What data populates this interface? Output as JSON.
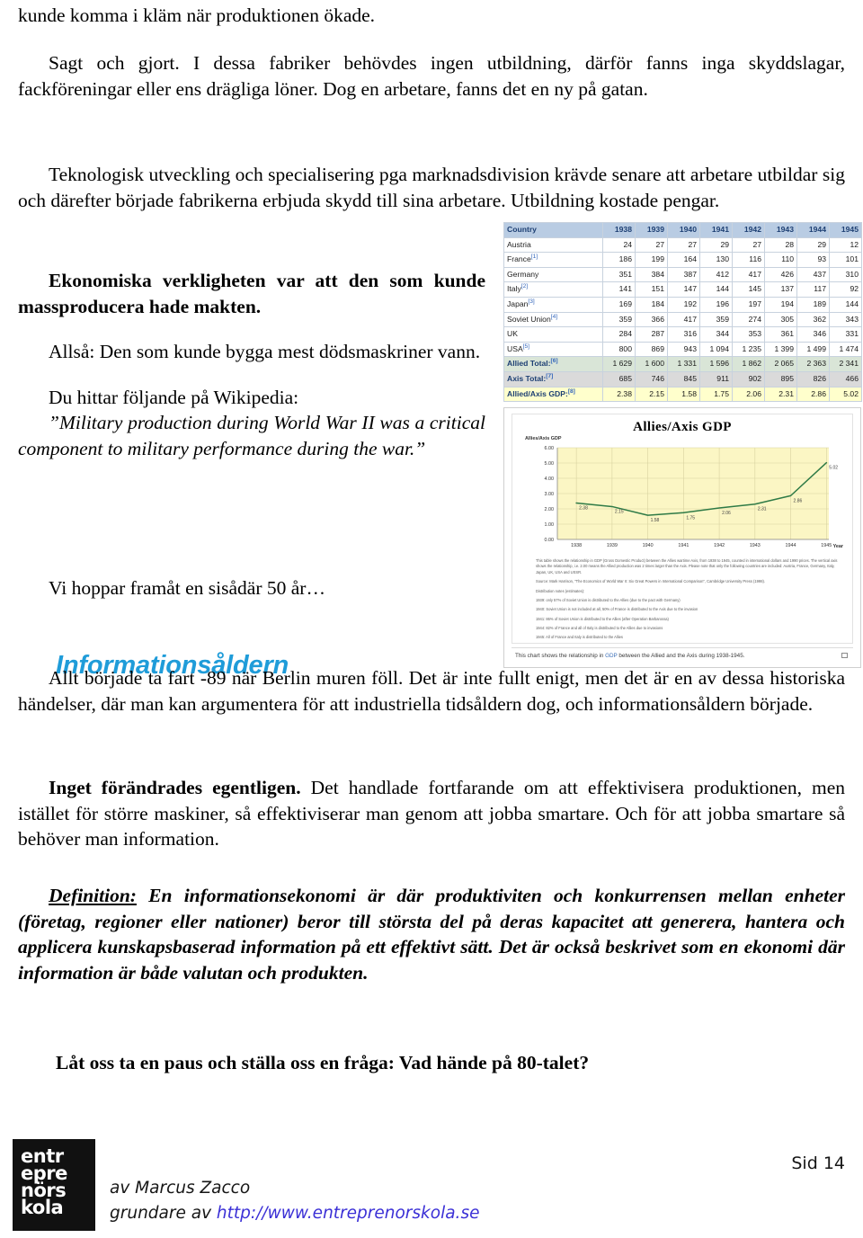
{
  "page": {
    "language": "sv",
    "page_label": "Sid 14",
    "heading_color": "#1f9cd9",
    "link_color": "#3b30d6"
  },
  "text": {
    "line_top": "kunde komma i kläm när produktionen ökade.",
    "para_fabriker": "Sagt och gjort. I dessa fabriker behövdes ingen utbildning, därför fanns inga skyddslagar, fackföreningar eller ens drägliga löner. Dog en arbetare, fanns det en ny på gatan.",
    "para_teknologisk": "Teknologisk utveckling och specialisering pga marknadsdivision krävde senare att arbetare utbildar sig och därefter började fabrikerna erbjuda skydd till sina arbetare. Utbildning kostade pengar.",
    "para_ekonomiska": "Ekonomiska verkligheten var att den som kunde massproducera hade makten.",
    "para_allsa": "Allså: Den som kunde bygga mest dödsmaskriner vann.",
    "para_wikipedia_intro": "Du hittar följande på Wikipedia:",
    "para_wikipedia_quote": "”Military production during World War II was a critical component to military performance during the war.”",
    "para_vihoppar": "Vi hoppar framåt en sisådär 50 år…",
    "heading_informationsaldern": "Informationsåldern",
    "para_allt_borjade": "Allt började ta fart -89 när Berlin muren föll. Det är inte fullt enigt, men det är en av dessa historiska händelser, där man kan argumentera för att industriella tidsåldern dog, och informationsåldern började.",
    "para_inget_bold": "Inget förändrades egentligen.",
    "para_inget_rest": " Det handlade fortfarande om att effektivisera produktionen, men istället för större maskiner, så effektiviserar man genom att jobba smartare. Och för att jobba smartare så behöver man information.",
    "para_definition_label": "Definition:",
    "para_definition_rest": " En informationsekonomi är där produktiviten och konkurrensen mellan enheter (företag, regioner eller nationer) beror till största del på deras kapacitet att generera, hantera och applicera kunskapsbaserad information på ett effektivt sätt. Det är också beskrivet som en ekonomi där information är både valutan och produkten.",
    "para_fraga": "Låt oss ta en paus och ställa oss en fråga: Vad hände på 80-talet?"
  },
  "figure": {
    "table": {
      "headers": [
        "Country",
        "1938",
        "1939",
        "1940",
        "1941",
        "1942",
        "1943",
        "1944",
        "1945"
      ],
      "rows": [
        {
          "name": "Austria",
          "ref": "",
          "style": "plain",
          "values": [
            "24",
            "27",
            "27",
            "29",
            "27",
            "28",
            "29",
            "12"
          ]
        },
        {
          "name": "France",
          "ref": "[1]",
          "style": "plain",
          "values": [
            "186",
            "199",
            "164",
            "130",
            "116",
            "110",
            "93",
            "101"
          ]
        },
        {
          "name": "Germany",
          "ref": "",
          "style": "plain",
          "values": [
            "351",
            "384",
            "387",
            "412",
            "417",
            "426",
            "437",
            "310"
          ]
        },
        {
          "name": "Italy",
          "ref": "[2]",
          "style": "plain",
          "values": [
            "141",
            "151",
            "147",
            "144",
            "145",
            "137",
            "117",
            "92"
          ]
        },
        {
          "name": "Japan",
          "ref": "[3]",
          "style": "plain",
          "values": [
            "169",
            "184",
            "192",
            "196",
            "197",
            "194",
            "189",
            "144"
          ]
        },
        {
          "name": "Soviet Union",
          "ref": "[4]",
          "style": "plain",
          "values": [
            "359",
            "366",
            "417",
            "359",
            "274",
            "305",
            "362",
            "343"
          ]
        },
        {
          "name": "UK",
          "ref": "",
          "style": "plain",
          "values": [
            "284",
            "287",
            "316",
            "344",
            "353",
            "361",
            "346",
            "331"
          ]
        },
        {
          "name": "USA",
          "ref": "[5]",
          "style": "plain",
          "values": [
            "800",
            "869",
            "943",
            "1 094",
            "1 235",
            "1 399",
            "1 499",
            "1 474"
          ]
        },
        {
          "name": "Allied Total:",
          "ref": "[6]",
          "style": "allied",
          "values": [
            "1 629",
            "1 600",
            "1 331",
            "1 596",
            "1 862",
            "2 065",
            "2 363",
            "2 341"
          ]
        },
        {
          "name": "Axis Total:",
          "ref": "[7]",
          "style": "axis",
          "values": [
            "685",
            "746",
            "845",
            "911",
            "902",
            "895",
            "826",
            "466"
          ]
        },
        {
          "name": "Allied/Axis GDP:",
          "ref": "[8]",
          "style": "gdp",
          "values": [
            "2.38",
            "2.15",
            "1.58",
            "1.75",
            "2.06",
            "2.31",
            "2.86",
            "5.02"
          ]
        }
      ]
    },
    "notes": [
      "This table shows the relationship in GDP (Gross Domestic Product) between the Allies wartime Axis, from 1938 to 1945, counted in international dollars and 1990 prices. The vertical axis shows the relationship, i.e. 2.00 means the Allied production was 2 times larger than the Axis. Please note that only the following countries are included: Austria, France, Germany, Italy, Japan, UK, USA and USSR.",
      "Source: Mark Harrison, \"The Economics of World War II: Six Great Powers in International Comparison\", Cambridge University Press (1998).",
      "Distribution notes (estimates):",
      "1939: only 57% of Soviet Union is distributed to the Allies (due to the pact with Germany)",
      "1940: Soviet Union is not included at all, 50% of France is distributed to the Axis due to the invasion",
      "1941: 86% of Soviet Union is distributed to the Allies (after Operation Barbarossa)",
      "1944: 82% of France and all of Italy is distributed to the Allies due to invasions",
      "1945: All of France and Italy is distributed to the Allies"
    ],
    "caption_pre": "This chart shows the relationship in ",
    "caption_link": "GDP",
    "caption_post": " between the Allied and the Axis during 1938-1945."
  },
  "chart_data": {
    "type": "line",
    "title": "Allies/Axis GDP",
    "xlabel": "Year",
    "ylabel": "Allies/Axis GDP",
    "categories": [
      "1938",
      "1939",
      "1940",
      "1941",
      "1942",
      "1943",
      "1944",
      "1945"
    ],
    "values": [
      2.38,
      2.15,
      1.58,
      1.75,
      2.06,
      2.31,
      2.86,
      5.02
    ],
    "point_labels": [
      "2.38",
      "2.15",
      "1.58",
      "1.75",
      "2.06",
      "2.31",
      "2.86",
      "5.02"
    ],
    "ylim": [
      0.0,
      6.0
    ],
    "ytick_step": 1.0,
    "yticks": [
      "0.00",
      "1.00",
      "2.00",
      "3.00",
      "4.00",
      "5.00",
      "6.00"
    ],
    "grid": true,
    "legend": "none",
    "plot_bg": "#fbf6c4",
    "line_color": "#2e7a46"
  },
  "footer": {
    "logo_lines": [
      "entr",
      "epre",
      "nörs",
      "kola"
    ],
    "byline": "av Marcus Zacco",
    "founder_prefix": "grundare av ",
    "founder_link": "http://www.entreprenorskola.se",
    "page_label": "Sid 14"
  }
}
